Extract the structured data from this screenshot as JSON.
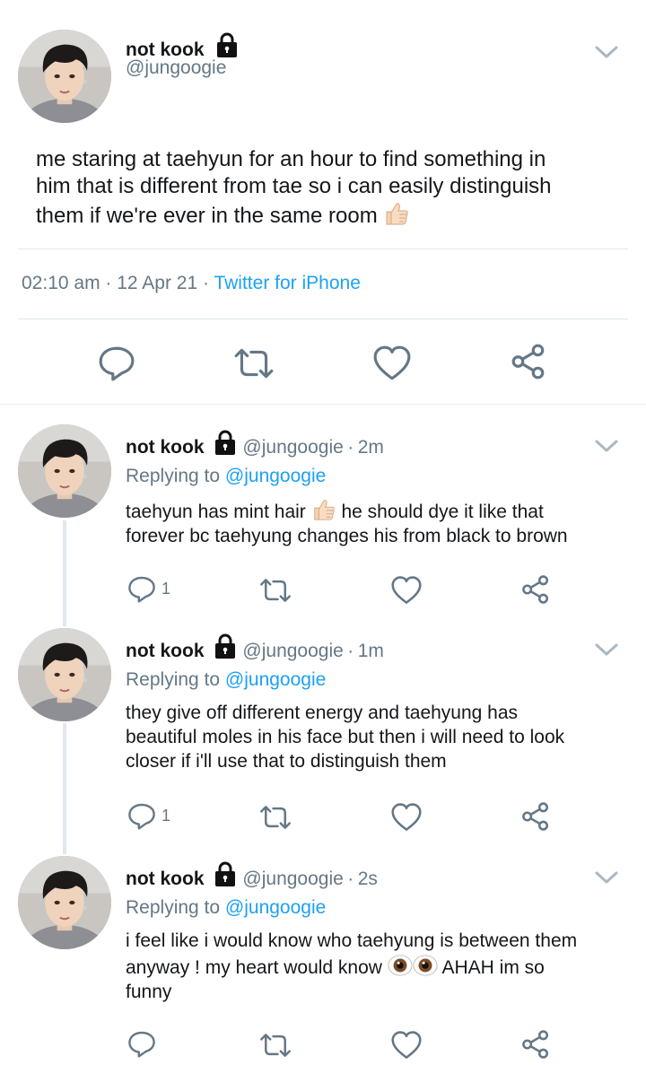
{
  "main_tweet": {
    "name": "not kook",
    "handle": "@jungoogie",
    "text_line1": "me staring at taehyun for an hour to find something in",
    "text_line2": "him that is different from tae so i can easily distinguish",
    "text_line3": "them if we're ever in the same room",
    "time": "02:10 am",
    "sep1": "·",
    "date": "12 Apr 21",
    "sep2": "·",
    "source": "Twitter for iPhone"
  },
  "replies": [
    {
      "name": "not kook",
      "handle": "@jungoogie",
      "dot": "·",
      "time": "2m",
      "replying_label": "Replying to",
      "replying_handle": "@jungoogie",
      "line1_a": "taehyun has mint hair",
      "line1_b": "he should dye it like that",
      "line2": "forever bc taehyung changes his from black to brown",
      "reply_count": "1"
    },
    {
      "name": "not kook",
      "handle": "@jungoogie",
      "dot": "·",
      "time": "1m",
      "replying_label": "Replying to",
      "replying_handle": "@jungoogie",
      "line1": "they give off different energy and taehyung has",
      "line2": "beautiful moles in his face but then i will need to look",
      "line3": "closer if i'll use that to distinguish them",
      "reply_count": "1"
    },
    {
      "name": "not kook",
      "handle": "@jungoogie",
      "dot": "·",
      "time": "2s",
      "replying_label": "Replying to",
      "replying_handle": "@jungoogie",
      "line1": "i feel like i would know who taehyung is between them",
      "line2_a": "anyway ! my heart would know",
      "line2_b": "AHAH im so",
      "line3": "funny",
      "reply_count": ""
    }
  ],
  "icons": {
    "reply": "reply-icon",
    "retweet": "retweet-icon",
    "like": "like-icon",
    "share": "share-icon",
    "lock": "lock-icon",
    "chevron": "chevron-down-icon",
    "thumbs_up": "thumbs-up-emoji",
    "eyes": "eyes-emoji"
  },
  "colors": {
    "text": "#14171a",
    "secondary": "#657786",
    "accent": "#1da1f2",
    "divider": "#e1e8ed"
  }
}
